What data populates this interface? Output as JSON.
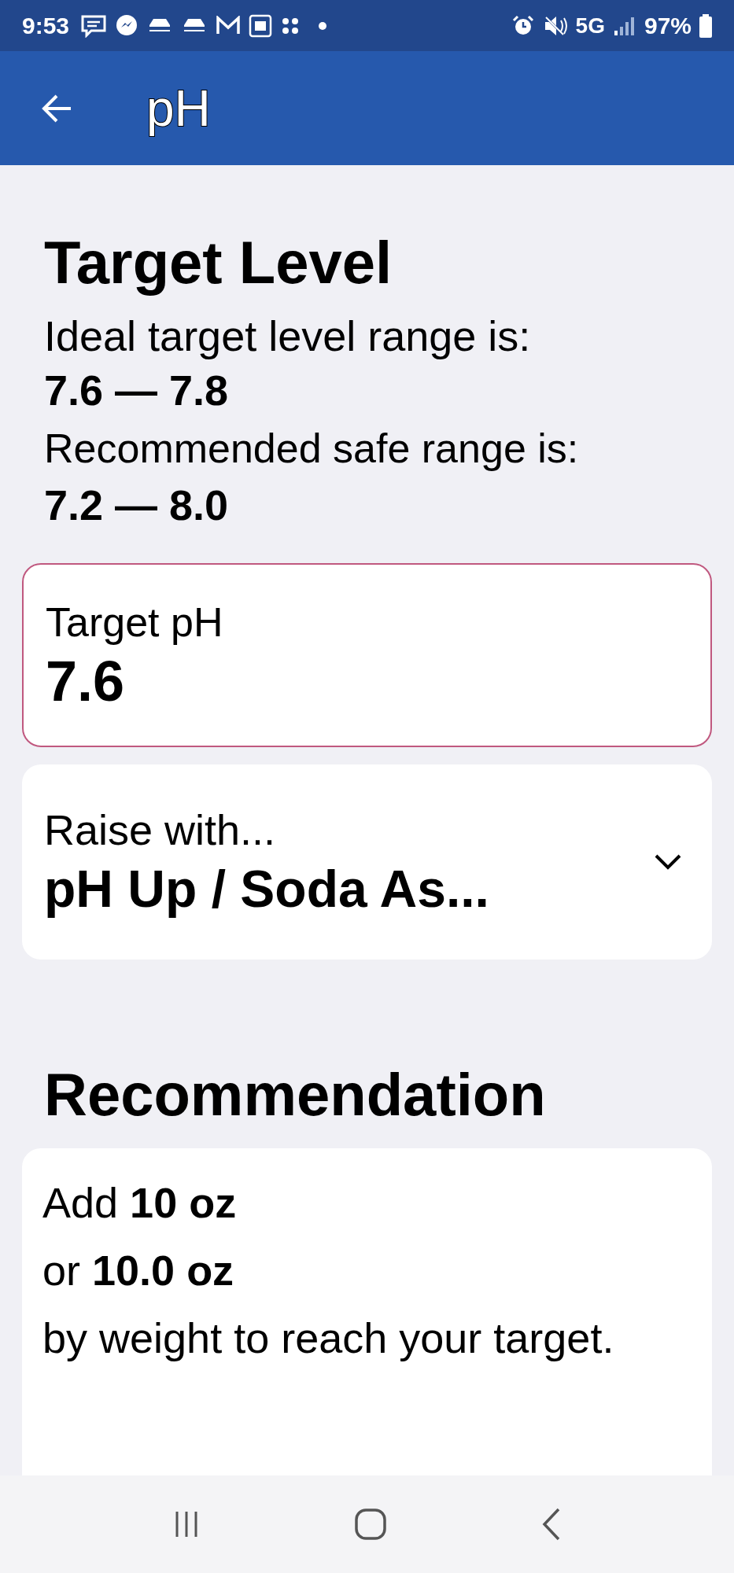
{
  "status_bar": {
    "time": "9:53",
    "network": "5G",
    "battery": "97%"
  },
  "app_bar": {
    "title": "pH"
  },
  "target_level": {
    "heading": "Target Level",
    "ideal_label": "Ideal target level range is:",
    "ideal_range": "7.6 — 7.8",
    "safe_label": "Recommended safe range is:",
    "safe_range": "7.2 — 8.0"
  },
  "target_field": {
    "label": "Target pH",
    "value": "7.6"
  },
  "raise_dropdown": {
    "label": "Raise with...",
    "value": "pH Up / Soda As..."
  },
  "recommendation": {
    "heading": "Recommendation",
    "lines": [
      "Add **10 oz**",
      "or **10.0 oz**",
      "by weight to reach your target."
    ]
  }
}
